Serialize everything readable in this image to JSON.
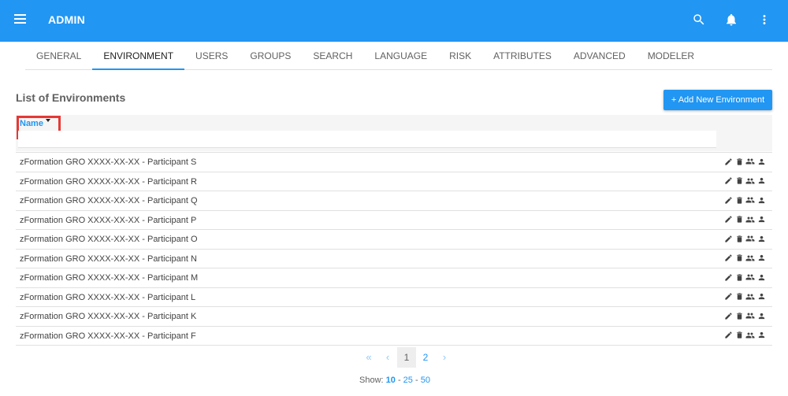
{
  "app": {
    "title": "ADMIN"
  },
  "tabs": [
    {
      "label": "GENERAL"
    },
    {
      "label": "ENVIRONMENT",
      "active": true
    },
    {
      "label": "USERS"
    },
    {
      "label": "GROUPS"
    },
    {
      "label": "SEARCH"
    },
    {
      "label": "LANGUAGE"
    },
    {
      "label": "RISK"
    },
    {
      "label": "ATTRIBUTES"
    },
    {
      "label": "ADVANCED"
    },
    {
      "label": "MODELER"
    }
  ],
  "list": {
    "title": "List of Environments",
    "add_button": "+ Add New Environment",
    "column_name": "Name",
    "filter_value": "",
    "rows": [
      "zFormation GRO XXXX-XX-XX - Participant S",
      "zFormation GRO XXXX-XX-XX - Participant R",
      "zFormation GRO XXXX-XX-XX - Participant Q",
      "zFormation GRO XXXX-XX-XX - Participant P",
      "zFormation GRO XXXX-XX-XX - Participant O",
      "zFormation GRO XXXX-XX-XX - Participant N",
      "zFormation GRO XXXX-XX-XX - Participant M",
      "zFormation GRO XXXX-XX-XX - Participant L",
      "zFormation GRO XXXX-XX-XX - Participant K",
      "zFormation GRO XXXX-XX-XX - Participant F"
    ],
    "row_actions": [
      "edit-icon",
      "delete-icon",
      "group-icon",
      "person-icon"
    ]
  },
  "pagination": {
    "first": "«",
    "prev": "‹",
    "pages": [
      "1",
      "2"
    ],
    "current": "1",
    "next": "›",
    "show_label": "Show:",
    "page_sizes": [
      "10",
      "25",
      "50"
    ],
    "page_size_selected": "10"
  },
  "colors": {
    "primary": "#2196f3",
    "highlight": "#e53935"
  }
}
